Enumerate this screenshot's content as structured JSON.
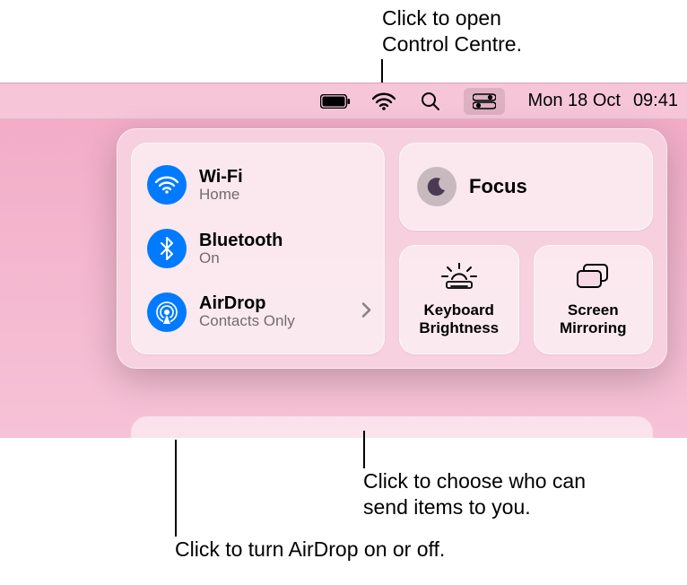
{
  "callouts": {
    "top": "Click to open\nControl Centre.",
    "chevron": "Click to choose who can\nsend items to you.",
    "airdrop_icon": "Click to turn AirDrop on or off."
  },
  "menubar": {
    "date": "Mon 18 Oct",
    "time": "09:41"
  },
  "control_centre": {
    "connectivity": {
      "wifi": {
        "title": "Wi-Fi",
        "sub": "Home"
      },
      "bluetooth": {
        "title": "Bluetooth",
        "sub": "On"
      },
      "airdrop": {
        "title": "AirDrop",
        "sub": "Contacts Only"
      }
    },
    "focus": {
      "label": "Focus"
    },
    "keyboard": {
      "label": "Keyboard\nBrightness"
    },
    "mirror": {
      "label": "Screen\nMirroring"
    }
  }
}
